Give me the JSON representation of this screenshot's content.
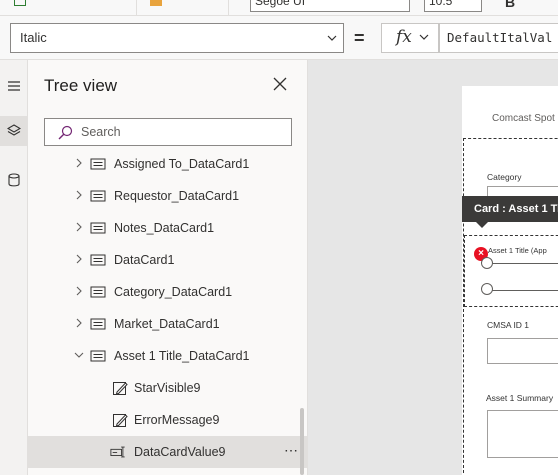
{
  "ribbon": {
    "font_name": "Segoe UI",
    "font_size": "10.5",
    "bold_label": "B"
  },
  "formula_bar": {
    "property": "Italic",
    "equals": "=",
    "fx_label": "fx",
    "formula": "DefaultItalVal"
  },
  "rail": {
    "items": [
      {
        "icon": "hamburger-menu-icon"
      },
      {
        "icon": "layers-icon",
        "active": true
      },
      {
        "icon": "database-icon"
      }
    ]
  },
  "tree": {
    "title": "Tree view",
    "search_placeholder": "Search",
    "items": [
      {
        "label": "Assigned To_DataCard1",
        "icon": "card-icon",
        "expanded": false
      },
      {
        "label": "Requestor_DataCard1",
        "icon": "card-icon",
        "expanded": false
      },
      {
        "label": "Notes_DataCard1",
        "icon": "card-icon",
        "expanded": false
      },
      {
        "label": "DataCard1",
        "icon": "card-icon",
        "expanded": false
      },
      {
        "label": "Category_DataCard1",
        "icon": "card-icon",
        "expanded": false
      },
      {
        "label": "Market_DataCard1",
        "icon": "card-icon",
        "expanded": false
      },
      {
        "label": "Asset 1 Title_DataCard1",
        "icon": "card-icon",
        "expanded": true
      },
      {
        "label": "StarVisible9",
        "icon": "edit-label-icon",
        "child": true
      },
      {
        "label": "ErrorMessage9",
        "icon": "edit-label-icon",
        "child": true
      },
      {
        "label": "DataCardValue9",
        "icon": "text-input-icon",
        "child": true,
        "selected": true
      }
    ],
    "more_label": "⋯"
  },
  "canvas": {
    "app_header": "Comcast Spot",
    "tooltip": "Card : Asset 1 Ti",
    "fields": {
      "category": "Category",
      "asset_title": "Asset 1 Title (App",
      "cmsa": "CMSA ID 1",
      "summary": "Asset 1 Summary"
    },
    "error_glyph": "×"
  },
  "colors": {
    "accent": "#742774",
    "error": "#e81123",
    "tooltip_bg": "#3b3a39"
  }
}
